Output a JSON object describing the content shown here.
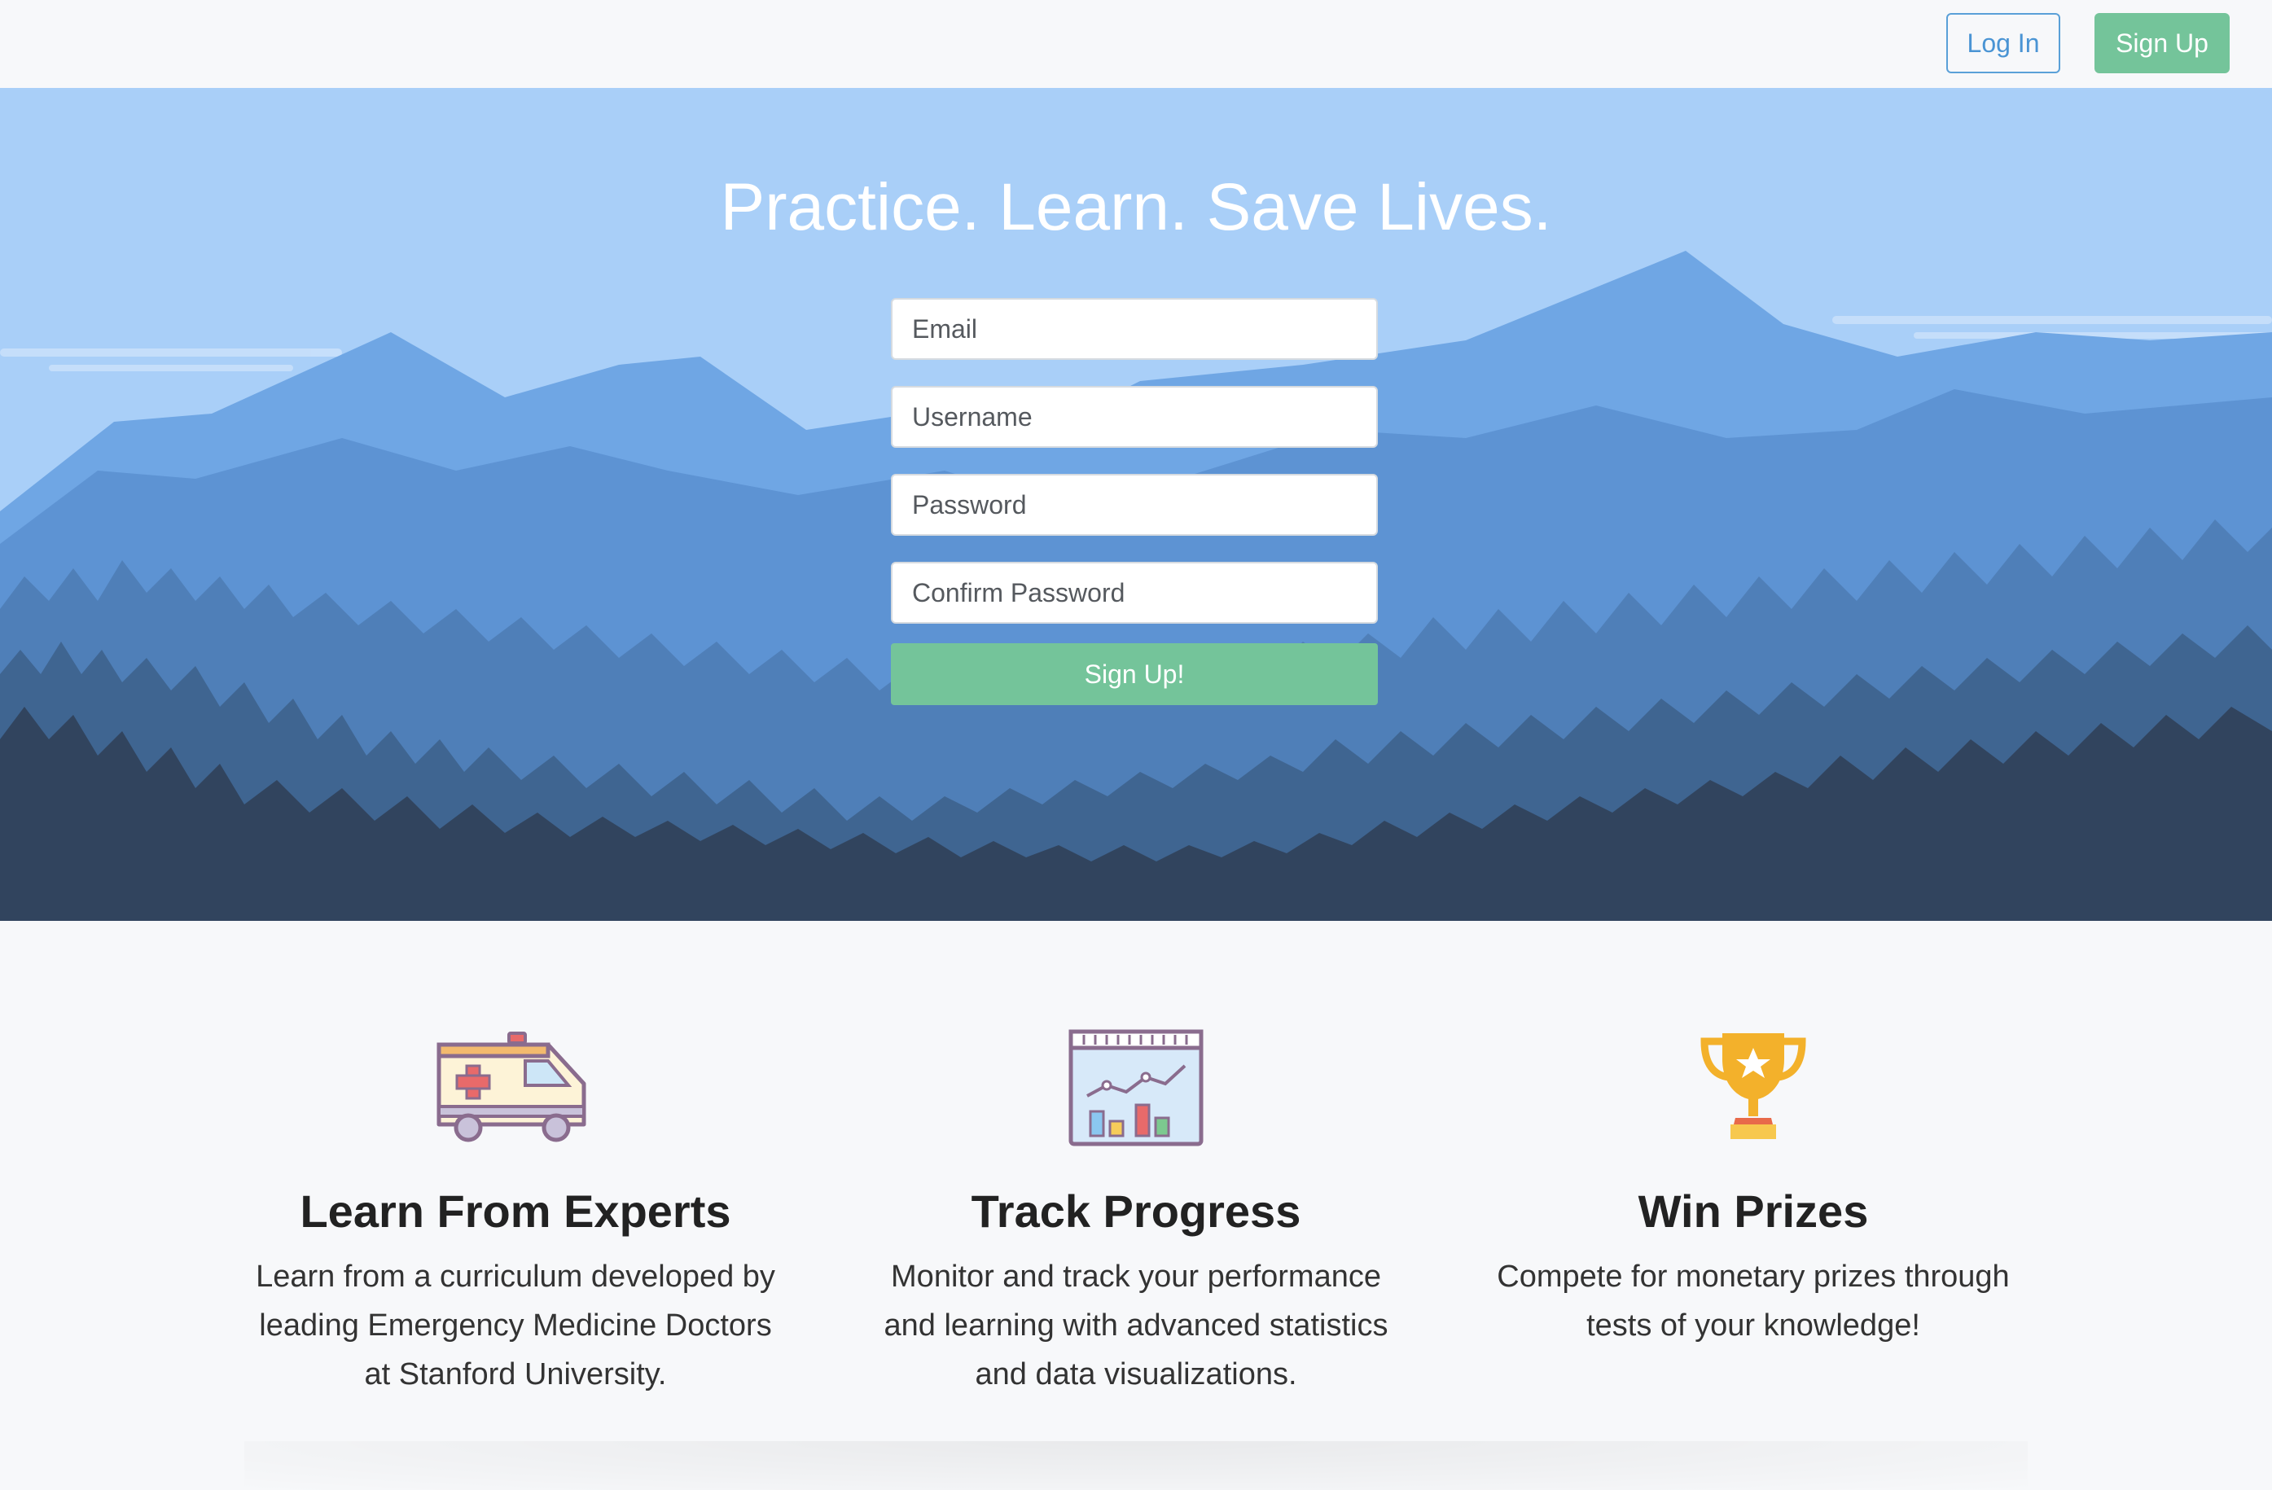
{
  "nav": {
    "login_label": "Log In",
    "signup_label": "Sign Up"
  },
  "hero": {
    "title": "Practice. Learn. Save Lives.",
    "form": {
      "email_placeholder": "Email",
      "username_placeholder": "Username",
      "password_placeholder": "Password",
      "confirm_password_placeholder": "Confirm Password",
      "submit_label": "Sign Up!"
    }
  },
  "features": [
    {
      "icon": "ambulance-icon",
      "title": "Learn From Experts",
      "text": "Learn from a curriculum developed by leading Emergency Medicine Doctors at Stanford University."
    },
    {
      "icon": "chart-dashboard-icon",
      "title": "Track Progress",
      "text": "Monitor and track your performance and learning with advanced statistics and data visualizations."
    },
    {
      "icon": "trophy-icon",
      "title": "Win Prizes",
      "text": "Compete for monetary prizes through tests of your knowledge!"
    }
  ],
  "colors": {
    "accent_green": "#74c49a",
    "accent_blue": "#4a94d4",
    "sky": "#a9cff8",
    "forest_dark": "#31445e"
  }
}
